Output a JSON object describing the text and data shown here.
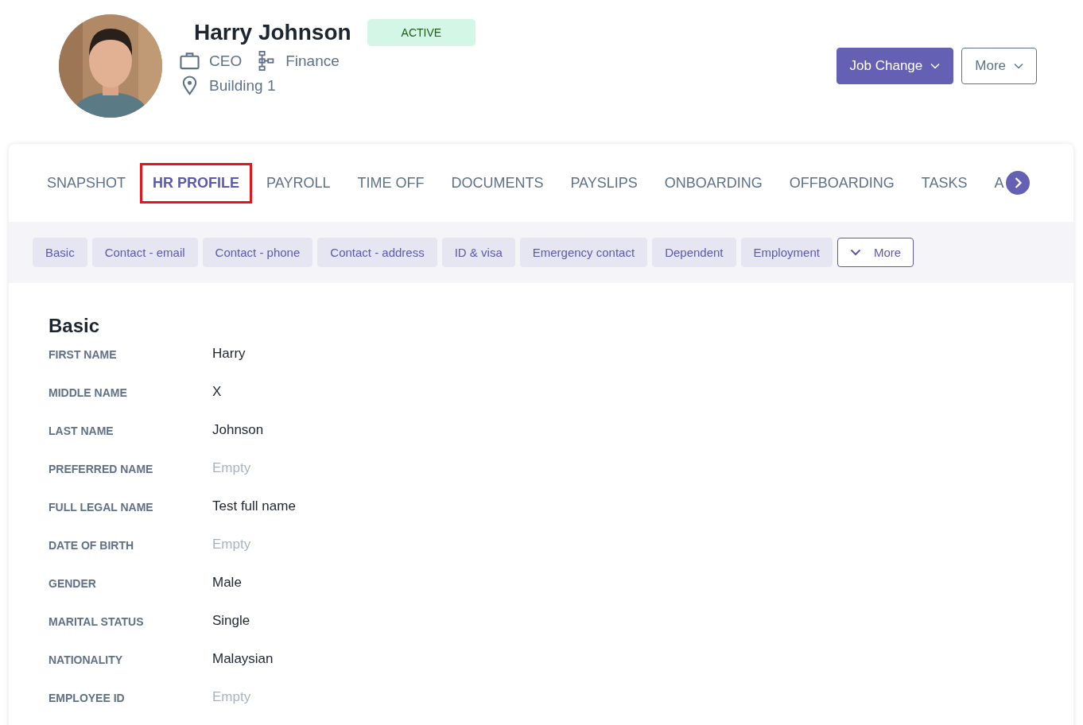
{
  "profile": {
    "name": "Harry Johnson",
    "status": "ACTIVE",
    "title": "CEO",
    "department": "Finance",
    "location": "Building 1"
  },
  "actions": [
    {
      "label": "Job Change",
      "kind": "primary"
    },
    {
      "label": "More",
      "kind": "secondary"
    }
  ],
  "tabs": [
    {
      "label": "SNAPSHOT",
      "selected": false
    },
    {
      "label": "HR PROFILE",
      "selected": true
    },
    {
      "label": "PAYROLL",
      "selected": false
    },
    {
      "label": "TIME OFF",
      "selected": false
    },
    {
      "label": "DOCUMENTS",
      "selected": false
    },
    {
      "label": "PAYSLIPS",
      "selected": false
    },
    {
      "label": "ONBOARDING",
      "selected": false
    },
    {
      "label": "OFFBOARDING",
      "selected": false
    },
    {
      "label": "TASKS",
      "selected": false
    },
    {
      "label": "A",
      "selected": false
    }
  ],
  "sections": [
    "Basic",
    "Contact - email",
    "Contact - phone",
    "Contact - address",
    "ID & visa",
    "Emergency contact",
    "Dependent",
    "Employment"
  ],
  "sections_more": "More",
  "section_title": "Basic",
  "fields": [
    {
      "label": "FIRST NAME",
      "value": "Harry",
      "empty": false
    },
    {
      "label": "MIDDLE NAME",
      "value": "X",
      "empty": false
    },
    {
      "label": "LAST NAME",
      "value": "Johnson",
      "empty": false
    },
    {
      "label": "PREFERRED NAME",
      "value": "Empty",
      "empty": true
    },
    {
      "label": "FULL LEGAL NAME",
      "value": "Test full name",
      "empty": false
    },
    {
      "label": "DATE OF BIRTH",
      "value": "Empty",
      "empty": true
    },
    {
      "label": "GENDER",
      "value": "Male",
      "empty": false
    },
    {
      "label": "MARITAL STATUS",
      "value": "Single",
      "empty": false
    },
    {
      "label": "NATIONALITY",
      "value": "Malaysian",
      "empty": false
    },
    {
      "label": "EMPLOYEE ID",
      "value": "Empty",
      "empty": true
    }
  ]
}
